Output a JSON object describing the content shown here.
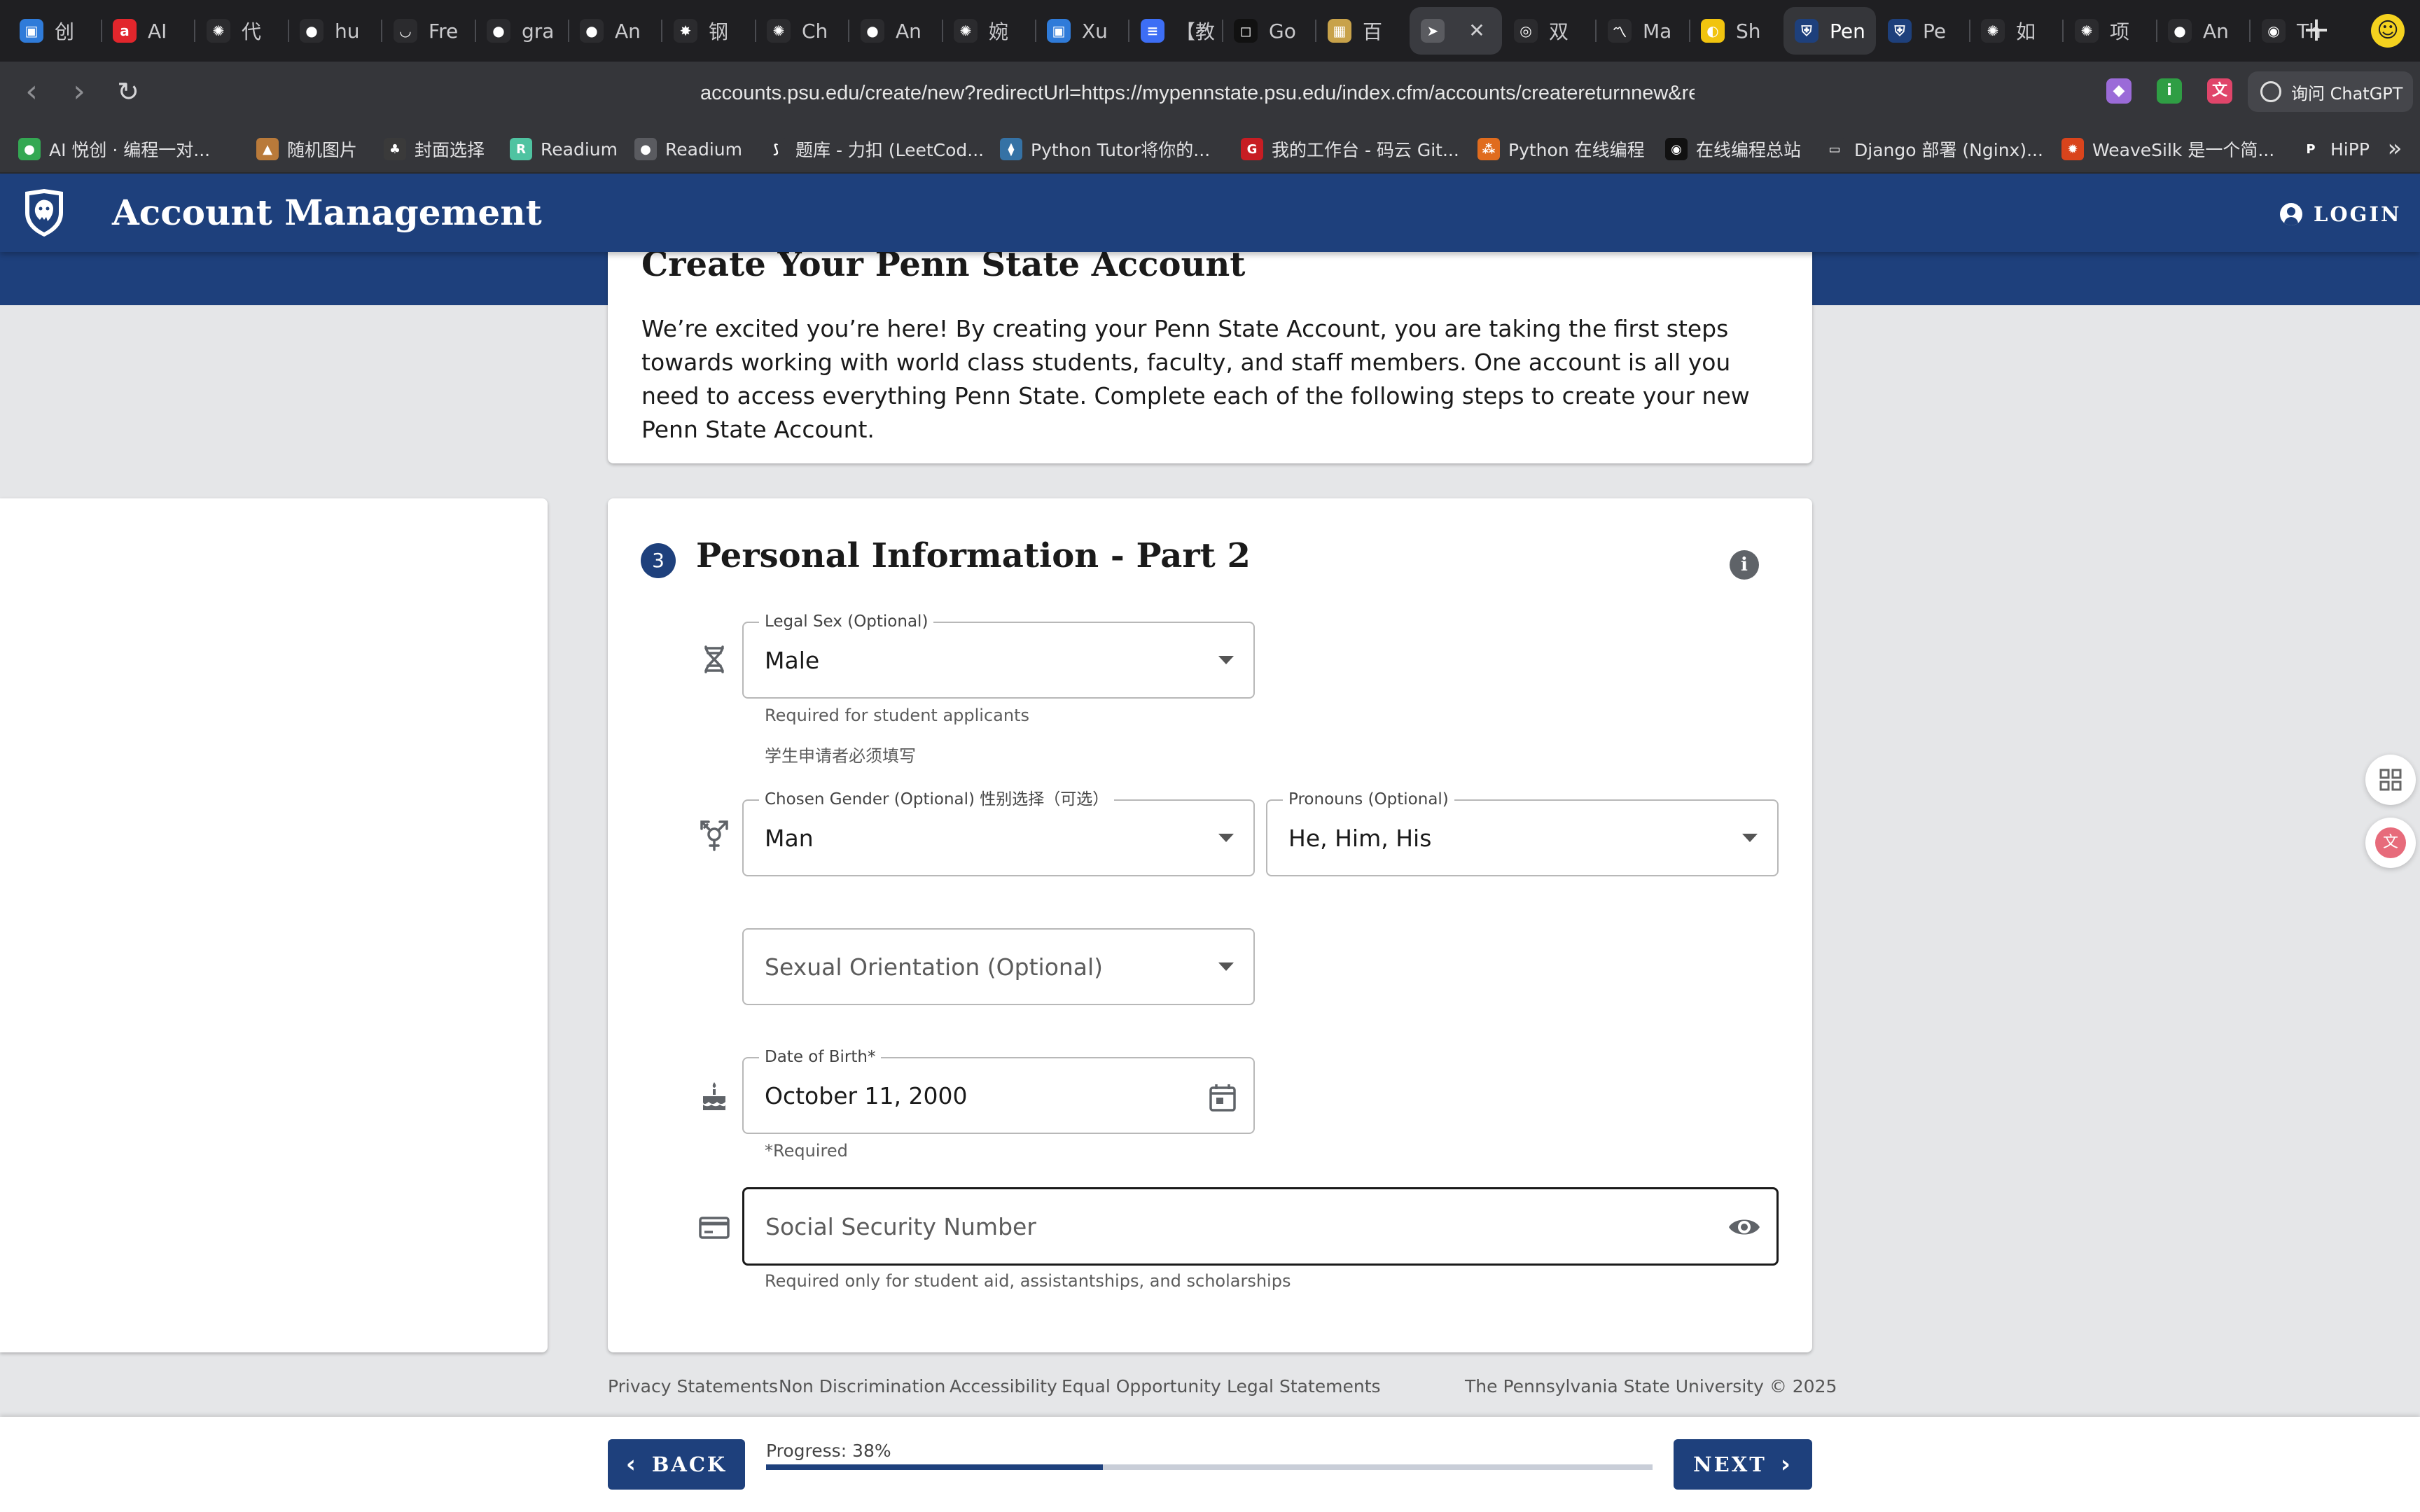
{
  "browser": {
    "tabs": [
      {
        "title": "创",
        "fav_color": "#2f7bd9",
        "fav_glyph": "▣"
      },
      {
        "title": "AI",
        "fav_color": "#e2262c",
        "fav_glyph": "a"
      },
      {
        "title": "代",
        "fav_color": "#2b2b2e",
        "fav_glyph": "✺"
      },
      {
        "title": "hu",
        "fav_color": "#2b2b2e",
        "fav_glyph": "●"
      },
      {
        "title": "Fre",
        "fav_color": "#2b2b2e",
        "fav_glyph": "◡"
      },
      {
        "title": "gra",
        "fav_color": "#2b2b2e",
        "fav_glyph": "●"
      },
      {
        "title": "An",
        "fav_color": "#2b2b2e",
        "fav_glyph": "●"
      },
      {
        "title": "钢",
        "fav_color": "#2b2b2e",
        "fav_glyph": "✸"
      },
      {
        "title": "Ch",
        "fav_color": "#2b2b2e",
        "fav_glyph": "✺"
      },
      {
        "title": "An",
        "fav_color": "#2b2b2e",
        "fav_glyph": "●"
      },
      {
        "title": "婉",
        "fav_color": "#2b2b2e",
        "fav_glyph": "✺"
      },
      {
        "title": "Xu",
        "fav_color": "#2f7bd9",
        "fav_glyph": "▣"
      },
      {
        "title": "【教",
        "fav_color": "#3d6ef5",
        "fav_glyph": "≡"
      },
      {
        "title": "Go",
        "fav_color": "#111111",
        "fav_glyph": "◻"
      },
      {
        "title": "百",
        "fav_color": "#c8a24a",
        "fav_glyph": "▦"
      },
      {
        "title": "",
        "fav_color": "#5a5b60",
        "fav_glyph": "➤"
      },
      {
        "title": "双",
        "fav_color": "#2b2b2e",
        "fav_glyph": "◎"
      },
      {
        "title": "Ma",
        "fav_color": "#2b2b2e",
        "fav_glyph": "〽"
      },
      {
        "title": "Sh",
        "fav_color": "#f1c40f",
        "fav_glyph": "◐"
      },
      {
        "title": "Pen",
        "fav_color": "#1e407c",
        "fav_glyph": "⛨"
      },
      {
        "title": "Pe",
        "fav_color": "#1e407c",
        "fav_glyph": "⛨"
      },
      {
        "title": "如",
        "fav_color": "#2b2b2e",
        "fav_glyph": "✺"
      },
      {
        "title": "项",
        "fav_color": "#2b2b2e",
        "fav_glyph": "✺"
      },
      {
        "title": "An",
        "fav_color": "#2b2b2e",
        "fav_glyph": "●"
      },
      {
        "title": "Th",
        "fav_color": "#2b2b2e",
        "fav_glyph": "◉"
      }
    ],
    "url": "accounts.psu.edu/create/new?redirectUrl=https://mypennstate.psu.edu/index.cfm/accounts/createreturnnew&refe",
    "chatgpt_label": "询问 ChatGPT",
    "bookmarks": [
      {
        "label": "AI 悦创 · 编程一对...",
        "fav_color": "#34a853",
        "fav_glyph": "●"
      },
      {
        "label": "随机图片",
        "fav_color": "#b97a3a",
        "fav_glyph": "▲"
      },
      {
        "label": "封面选择",
        "fav_color": "#3a3a3a",
        "fav_glyph": "♣"
      },
      {
        "label": "Readium",
        "fav_color": "#4fc3a1",
        "fav_glyph": "R"
      },
      {
        "label": "Readium",
        "fav_color": "#5a5b60",
        "fav_glyph": "●"
      },
      {
        "label": "题库 - 力扣 (LeetCod...",
        "fav_color": "#35363a",
        "fav_glyph": "⟆"
      },
      {
        "label": "Python Tutor将你的...",
        "fav_color": "#3572a5",
        "fav_glyph": "⧫"
      },
      {
        "label": "我的工作台 - 码云 Git...",
        "fav_color": "#c71d23",
        "fav_glyph": "G"
      },
      {
        "label": "Python 在线编程",
        "fav_color": "#e06c1e",
        "fav_glyph": "⁂"
      },
      {
        "label": "在线编程总站",
        "fav_color": "#111111",
        "fav_glyph": "◉"
      },
      {
        "label": "Django 部署 (Nginx)...",
        "fav_color": "#35363a",
        "fav_glyph": "▭"
      },
      {
        "label": "WeaveSilk 是一个简...",
        "fav_color": "#d9441c",
        "fav_glyph": "✹"
      },
      {
        "label": "HiPP",
        "fav_color": "#35363a",
        "fav_glyph": "P"
      }
    ]
  },
  "header": {
    "title": "Account Management",
    "login_label": "LOGIN"
  },
  "intro": {
    "title": "Create Your Penn State Account",
    "text": "We’re excited you’re here! By creating your Penn State Account, you are taking the first steps towards working with world class students, faculty, and staff members. One account is all you need to access everything Penn State. Complete each of the following steps to create your new Penn State Account."
  },
  "step": {
    "number": "3",
    "title": "Personal Information - Part 2"
  },
  "form": {
    "legal_sex": {
      "label": "Legal Sex (Optional)",
      "value": "Male",
      "helper1": "Required for student applicants",
      "helper2": "学生申请者必须填写"
    },
    "gender": {
      "label": "Chosen Gender (Optional)  性别选择（可选）",
      "value": "Man"
    },
    "pronouns": {
      "label": "Pronouns (Optional)",
      "value": "He, Him, His"
    },
    "orientation": {
      "placeholder": "Sexual Orientation (Optional)"
    },
    "dob": {
      "label": "Date of Birth*",
      "value": "October 11, 2000",
      "helper": "*Required"
    },
    "ssn": {
      "placeholder": "Social Security Number",
      "helper": "Required only for student aid, assistantships, and scholarships"
    }
  },
  "footer": {
    "links": [
      "Privacy Statements",
      "Non Discrimination",
      "Accessibility",
      "Equal Opportunity",
      "Legal Statements"
    ],
    "copyright": "The Pennsylvania State University © 2025"
  },
  "bottom": {
    "back_label": "BACK",
    "next_label": "NEXT",
    "progress_label": "Progress: 38%",
    "progress_percent": 38
  },
  "colors": {
    "brand_navy": "#1e407c",
    "page_bg": "#e5e6e8"
  }
}
